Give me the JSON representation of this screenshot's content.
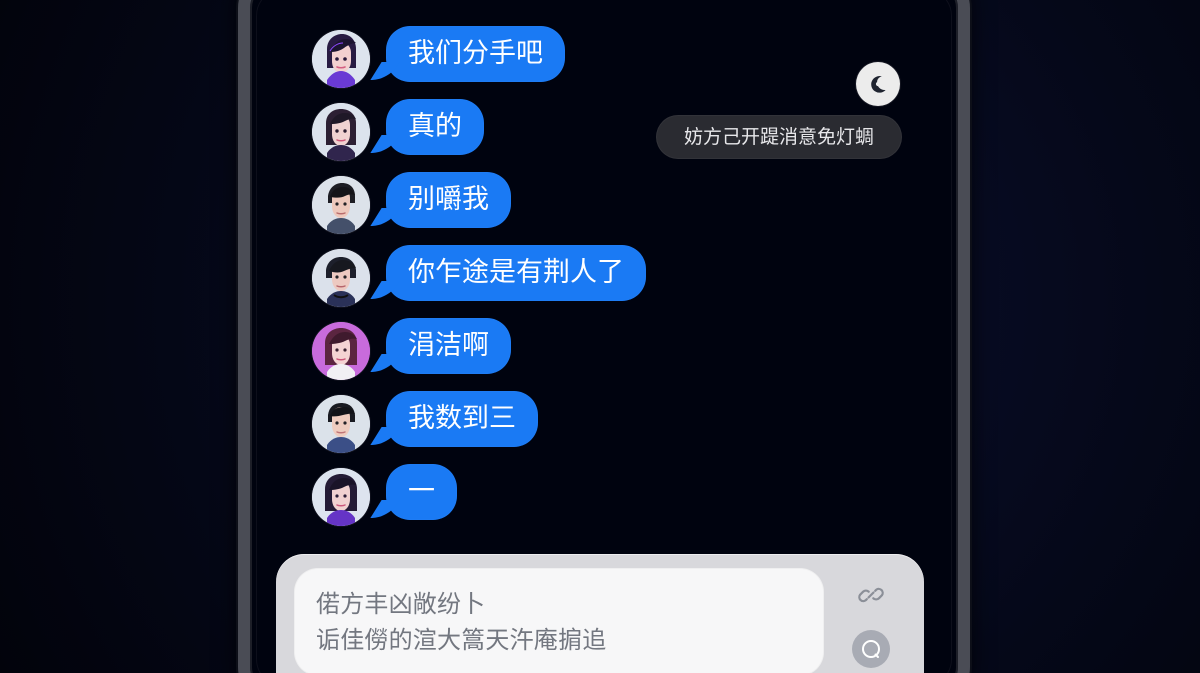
{
  "chat": {
    "messages": [
      {
        "avatar": "woman-avatar-1",
        "text": "我们分手吧"
      },
      {
        "avatar": "woman-avatar-2",
        "text": "真的"
      },
      {
        "avatar": "man-avatar-1",
        "text": "别嚼我"
      },
      {
        "avatar": "man-avatar-2",
        "text": "你乍途是有荆人了"
      },
      {
        "avatar": "woman-avatar-pink",
        "text": "涓洁啊"
      },
      {
        "avatar": "man-avatar-3",
        "text": "我数到三"
      },
      {
        "avatar": "woman-avatar-3",
        "text": "一"
      }
    ],
    "system_notice": {
      "icon": "moon-icon",
      "text": "妨方己开踶消意免灯蜩"
    }
  },
  "bottom_panel": {
    "lines": [
      "偌方丰凶敞纷卜",
      "诟佳僗的渲大篙天汻庵掮追"
    ],
    "top_icon": "link-icon",
    "bottom_icon": "reply-icon"
  },
  "colors": {
    "background": "#040617",
    "bubble": "#1A7AF4",
    "notice": "#2A2B31",
    "panel": "#D8D8DC",
    "card": "#F7F7F8"
  }
}
